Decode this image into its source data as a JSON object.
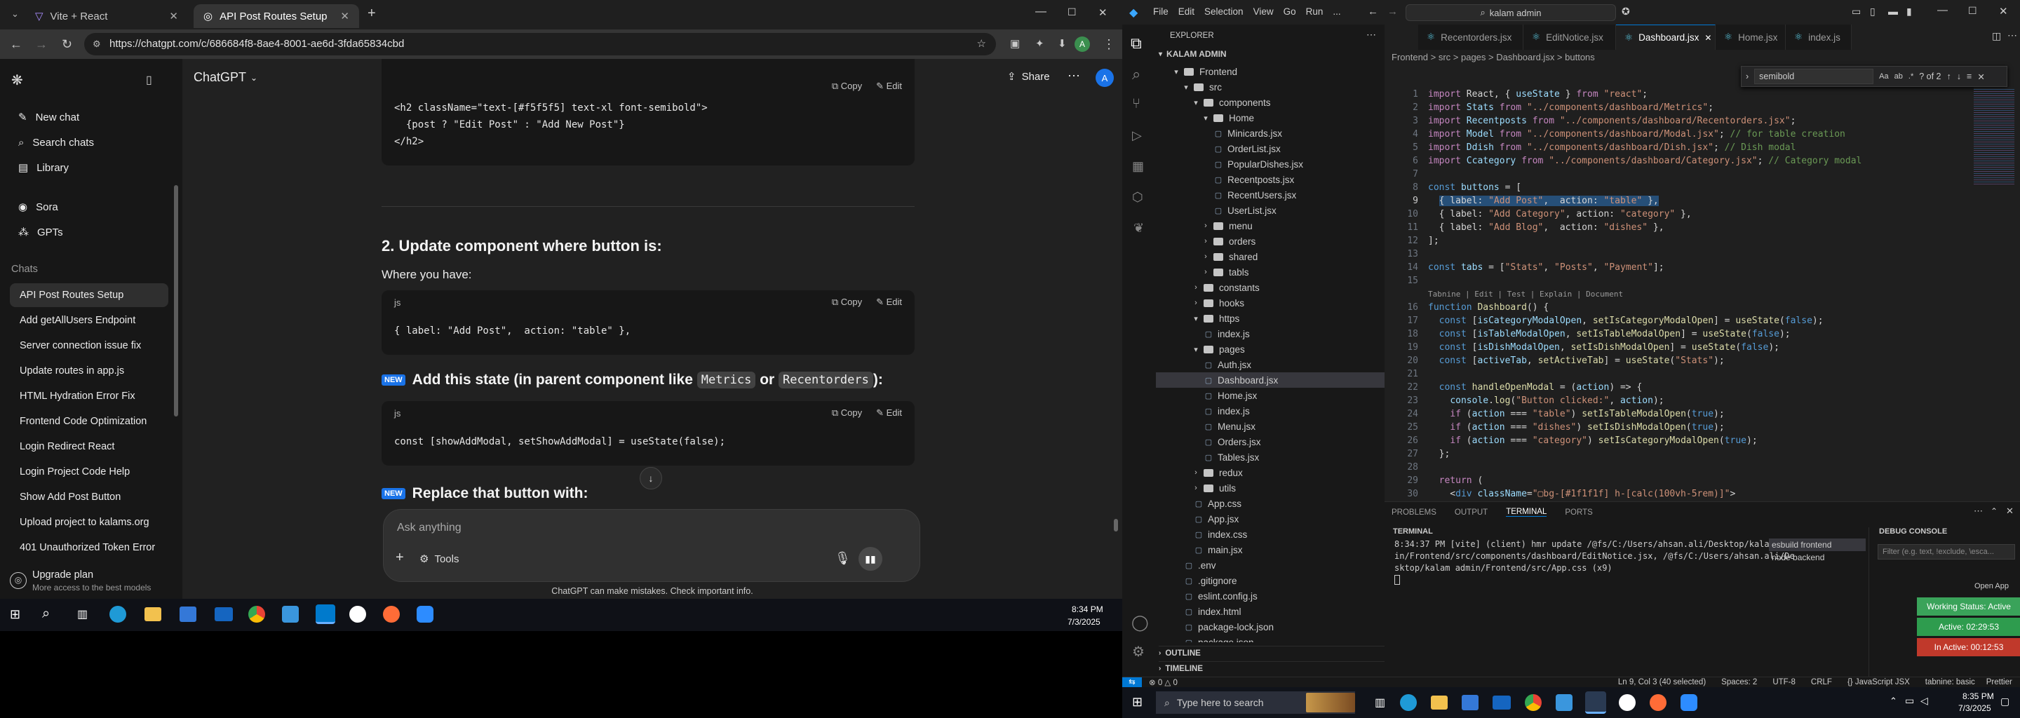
{
  "browser": {
    "tabs": [
      {
        "title": "Vite + React"
      },
      {
        "title": "API Post Routes Setup"
      }
    ],
    "url": "https://chatgpt.com/c/686684f8-8ae4-8001-ae6d-3fda65834cbd"
  },
  "chatgpt": {
    "model": "ChatGPT",
    "share_label": "Share",
    "avatar_initial": "A",
    "nav": [
      {
        "label": "New chat"
      },
      {
        "label": "Search chats"
      },
      {
        "label": "Library"
      },
      {
        "label": "Sora"
      },
      {
        "label": "GPTs"
      }
    ],
    "chats_heading": "Chats",
    "chats": [
      "API Post Routes Setup",
      "Add getAllUsers Endpoint",
      "Server connection issue fix",
      "Update routes in app.js",
      "HTML Hydration Error Fix",
      "Frontend Code Optimization",
      "Login Redirect React",
      "Login Project Code Help",
      "Show Add Post Button",
      "Upload project to kalams.org",
      "401 Unauthorized Token Error"
    ],
    "upgrade": {
      "title": "Upgrade plan",
      "subtitle": "More access to the best models"
    },
    "copy_label": "Copy",
    "edit_label": "Edit",
    "lang_label": "js",
    "code1": {
      "line1": "<h2 className=\"text-[#f5f5f5] text-xl font-semibold\">",
      "line2": "  {post ? \"Edit Post\" : \"Add New Post\"}",
      "line3": "</h2>"
    },
    "section2_title": "2. Update component where button is:",
    "section2_text": "Where you have:",
    "code2": "{ label: \"Add Post\",  action: \"table\" },",
    "section3": {
      "badge": "🆕",
      "title_pre": "Add this state (in parent component like ",
      "code_a": "Metrics",
      "mid": " or ",
      "code_b": "Recentorders",
      "title_post": "):"
    },
    "code3": "const [showAddModal, setShowAddModal] = useState(false);",
    "section4": {
      "badge": "🆕",
      "title": "Replace that button with:"
    },
    "input_placeholder": "Ask anything",
    "tools_label": "Tools",
    "disclaimer": "ChatGPT can make mistakes. Check important info."
  },
  "taskbar_left": {
    "time": "8:34 PM",
    "date": "7/3/2025"
  },
  "vscode": {
    "menu": [
      "File",
      "Edit",
      "Selection",
      "View",
      "Go",
      "Run",
      "..."
    ],
    "search": "kalam admin",
    "explorer_title": "EXPLORER",
    "root": "KALAM ADMIN",
    "tree": [
      {
        "d": 1,
        "t": "folder",
        "open": true,
        "name": "Frontend"
      },
      {
        "d": 2,
        "t": "folder",
        "open": true,
        "name": "src"
      },
      {
        "d": 3,
        "t": "folder",
        "open": true,
        "name": "components"
      },
      {
        "d": 4,
        "t": "folder",
        "open": true,
        "name": "Home"
      },
      {
        "d": 5,
        "t": "file",
        "name": "Minicards.jsx"
      },
      {
        "d": 5,
        "t": "file",
        "name": "OrderList.jsx"
      },
      {
        "d": 5,
        "t": "file",
        "name": "PopularDishes.jsx"
      },
      {
        "d": 5,
        "t": "file",
        "name": "Recentposts.jsx"
      },
      {
        "d": 5,
        "t": "file",
        "name": "RecentUsers.jsx"
      },
      {
        "d": 5,
        "t": "file",
        "name": "UserList.jsx"
      },
      {
        "d": 4,
        "t": "folder",
        "open": false,
        "name": "menu"
      },
      {
        "d": 4,
        "t": "folder",
        "open": false,
        "name": "orders"
      },
      {
        "d": 4,
        "t": "folder",
        "open": false,
        "name": "shared"
      },
      {
        "d": 4,
        "t": "folder",
        "open": false,
        "name": "tabls"
      },
      {
        "d": 3,
        "t": "folder",
        "open": false,
        "name": "constants"
      },
      {
        "d": 3,
        "t": "folder",
        "open": false,
        "name": "hooks"
      },
      {
        "d": 3,
        "t": "folder",
        "open": true,
        "name": "https"
      },
      {
        "d": 4,
        "t": "file",
        "name": "index.js"
      },
      {
        "d": 3,
        "t": "folder",
        "open": true,
        "name": "pages"
      },
      {
        "d": 4,
        "t": "file",
        "name": "Auth.jsx"
      },
      {
        "d": 4,
        "t": "file",
        "name": "Dashboard.jsx",
        "sel": true
      },
      {
        "d": 4,
        "t": "file",
        "name": "Home.jsx"
      },
      {
        "d": 4,
        "t": "file",
        "name": "index.js"
      },
      {
        "d": 4,
        "t": "file",
        "name": "Menu.jsx"
      },
      {
        "d": 4,
        "t": "file",
        "name": "Orders.jsx"
      },
      {
        "d": 4,
        "t": "file",
        "name": "Tables.jsx"
      },
      {
        "d": 3,
        "t": "folder",
        "open": false,
        "name": "redux"
      },
      {
        "d": 3,
        "t": "folder",
        "open": false,
        "name": "utils"
      },
      {
        "d": 3,
        "t": "file",
        "name": "App.css"
      },
      {
        "d": 3,
        "t": "file",
        "name": "App.jsx"
      },
      {
        "d": 3,
        "t": "file",
        "name": "index.css"
      },
      {
        "d": 3,
        "t": "file",
        "name": "main.jsx"
      },
      {
        "d": 2,
        "t": "file",
        "name": ".env"
      },
      {
        "d": 2,
        "t": "file",
        "name": ".gitignore"
      },
      {
        "d": 2,
        "t": "file",
        "name": "eslint.config.js"
      },
      {
        "d": 2,
        "t": "file",
        "name": "index.html"
      },
      {
        "d": 2,
        "t": "file",
        "name": "package-lock.json"
      },
      {
        "d": 2,
        "t": "file",
        "name": "package.json"
      }
    ],
    "outline_label": "OUTLINE",
    "timeline_label": "TIMELINE",
    "tabs": [
      "Recentorders.jsx",
      "EditNotice.jsx",
      "Dashboard.jsx",
      "Home.jsx",
      "index.js"
    ],
    "breadcrumb": "Frontend > src > pages > Dashboard.jsx > buttons",
    "find": {
      "query": "semibold",
      "count": "? of 2"
    },
    "codelens": "Tabnine | Edit | Test | Explain | Document",
    "panel_tabs": [
      "PROBLEMS",
      "OUTPUT",
      "TERMINAL",
      "PORTS"
    ],
    "terminal_label": "TERMINAL",
    "terminal_lines": [
      "8:34:37 PM [vite] (client) hmr update /@fs/C:/Users/ahsan.ali/Desktop/kalam adm",
      "in/Frontend/src/components/dashboard/EditNotice.jsx, /@fs/C:/Users/ahsan.ali/De",
      "sktop/kalam admin/Frontend/src/App.css (x9)"
    ],
    "terminals": [
      "esbuild frontend",
      "node backend"
    ],
    "debug_title": "DEBUG CONSOLE",
    "debug_filter": "Filter (e.g. text, !exclude, \\esca...",
    "open_app": "Open App",
    "badges": [
      {
        "text": "Working Status: Active",
        "color": "#3aa35a"
      },
      {
        "text": "Active: 02:29:53",
        "color": "#2e9c4e"
      },
      {
        "text": "In Active: 00:12:53",
        "color": "#c0392b"
      }
    ],
    "status": {
      "left": "⊗ 0 △ 0",
      "pos": "Ln 9, Col 3 (40 selected)",
      "spaces": "Spaces: 2",
      "enc": "UTF-8",
      "eol": "CRLF",
      "lang": "{} JavaScript JSX",
      "tabnine": "tabnine: basic",
      "prettier": "Prettier"
    }
  },
  "taskbar_right": {
    "search": "Type here to search",
    "time": "8:35 PM",
    "date": "7/3/2025"
  }
}
